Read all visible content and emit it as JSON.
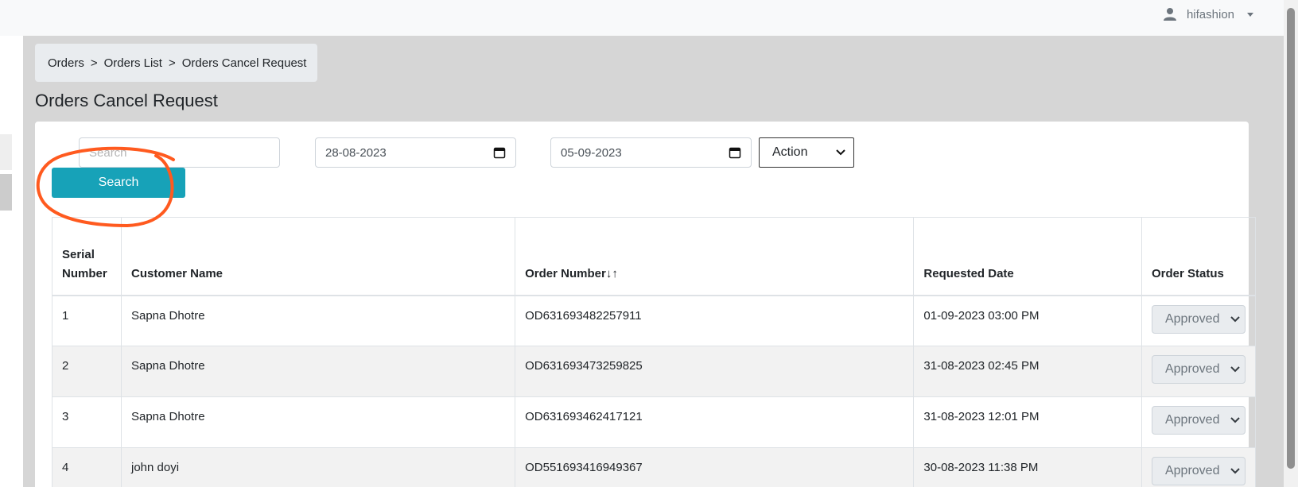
{
  "header": {
    "username": "hifashion",
    "user_icon": "user-icon"
  },
  "breadcrumb": {
    "items": [
      "Orders",
      "Orders List",
      "Orders Cancel Request"
    ],
    "separator": ">"
  },
  "page": {
    "title": "Orders Cancel Request"
  },
  "filters": {
    "search_placeholder": "Search",
    "start_date": "28-08-2023",
    "end_date": "05-09-2023",
    "action_selected": "Action",
    "search_button": "Search"
  },
  "table": {
    "columns": [
      "Serial Number",
      "Customer Name",
      "Order Number",
      "Requested Date",
      "Order Status"
    ],
    "sort_indicator": "↓↑",
    "rows": [
      {
        "serial": "1",
        "customer": "Sapna Dhotre",
        "order": "OD631693482257911",
        "date": "01-09-2023 03:00 PM",
        "status": "Approved"
      },
      {
        "serial": "2",
        "customer": "Sapna Dhotre",
        "order": "OD631693473259825",
        "date": "31-08-2023 02:45 PM",
        "status": "Approved"
      },
      {
        "serial": "3",
        "customer": "Sapna Dhotre",
        "order": "OD631693462417121",
        "date": "31-08-2023 12:01 PM",
        "status": "Approved"
      },
      {
        "serial": "4",
        "customer": "john doyi",
        "order": "OD551693416949367",
        "date": "30-08-2023 11:38 PM",
        "status": "Approved"
      }
    ]
  },
  "colors": {
    "accent": "#17a2b8",
    "annotation": "#ff5a1f"
  }
}
